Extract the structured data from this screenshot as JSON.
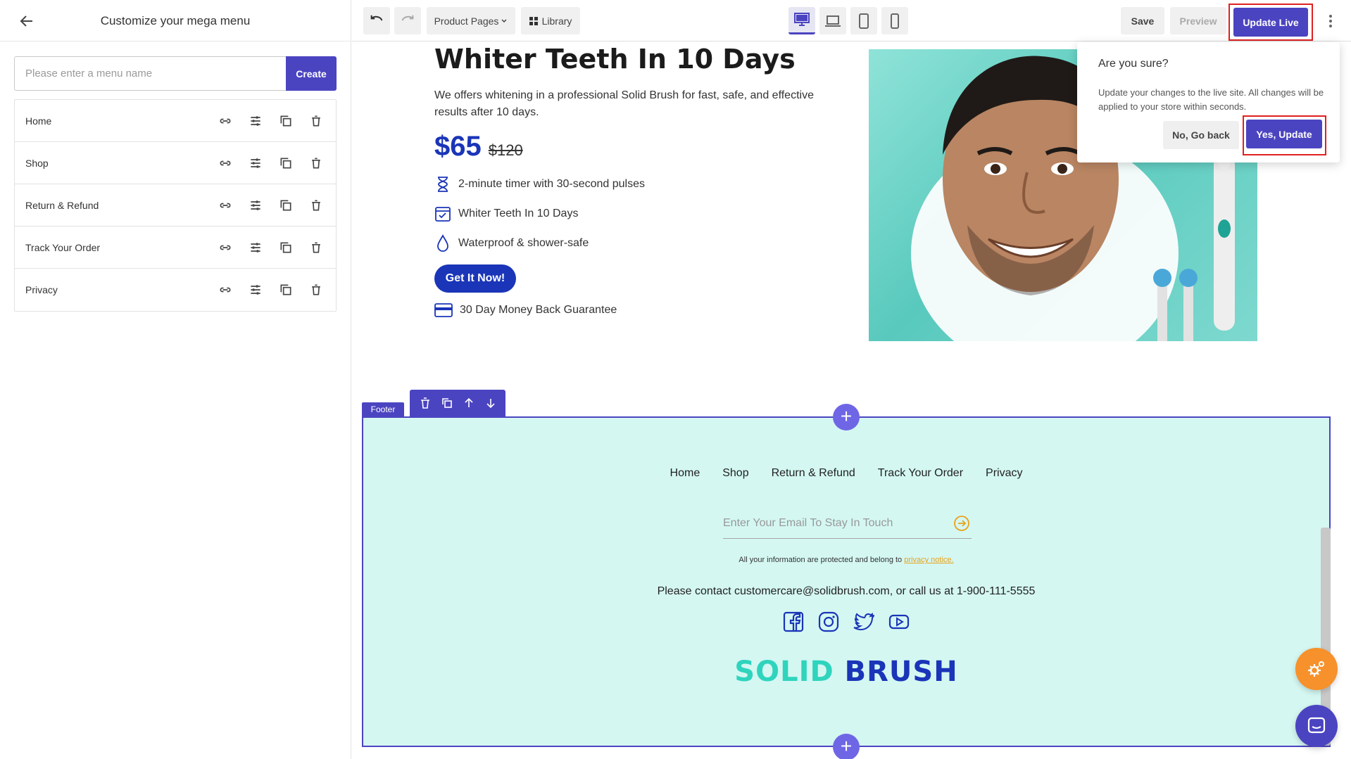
{
  "sidebar": {
    "title": "Customize your mega menu",
    "input_placeholder": "Please enter a menu name",
    "input_value": "",
    "create_label": "Create",
    "items": [
      {
        "label": "Home"
      },
      {
        "label": "Shop"
      },
      {
        "label": "Return & Refund"
      },
      {
        "label": "Track Your Order"
      },
      {
        "label": "Privacy"
      }
    ],
    "row_icons": [
      "link-icon",
      "tune-icon",
      "duplicate-icon",
      "trash-icon"
    ]
  },
  "toolbar": {
    "pages_label": "Product Pages",
    "library_label": "Library",
    "save_label": "Save",
    "preview_label": "Preview",
    "update_live_label": "Update Live",
    "active_device": "desktop"
  },
  "hero": {
    "title": "Whiter Teeth In 10 Days",
    "description": "We offers whitening in a professional Solid Brush for fast, safe, and effective results after 10 days.",
    "price": "$65",
    "old_price": "$120",
    "features": [
      {
        "text": "2-minute timer with 30-second pulses",
        "icon": "hourglass-icon"
      },
      {
        "text": "Whiter Teeth In 10 Days",
        "icon": "calendar-check-icon"
      },
      {
        "text": "Waterproof & shower-safe",
        "icon": "water-drop-icon"
      }
    ],
    "cta_label": "Get It Now!",
    "guarantee": "30 Day Money Back Guarantee"
  },
  "footer": {
    "tag_label": "Footer",
    "nav": [
      "Home",
      "Shop",
      "Return & Refund",
      "Track Your Order",
      "Privacy"
    ],
    "email_placeholder": "Enter Your Email To Stay In Touch",
    "privacy_text": "All your information are protected and belong to",
    "privacy_link": "privacy notice.",
    "contact_prefix": "Please contact",
    "contact_email": "customercare@solidbrush.com",
    "contact_mid": ", or call us at",
    "contact_phone": "1-900-111-5555",
    "social": [
      "facebook-icon",
      "instagram-icon",
      "twitter-icon",
      "youtube-icon"
    ],
    "brand_part1": "SOLID",
    "brand_part2": "BRUSH"
  },
  "confirm": {
    "title": "Are you sure?",
    "message": "Update your changes to the live site. All changes will be applied to your store within seconds.",
    "no_label": "No, Go back",
    "yes_label": "Yes, Update"
  },
  "colors": {
    "accent": "#4b44c1",
    "price_blue": "#1a35b8",
    "footer_bg": "#d4f7f2",
    "brand_teal": "#2fd4bd",
    "highlight_red": "#e02020",
    "fab_orange": "#f6912b"
  }
}
